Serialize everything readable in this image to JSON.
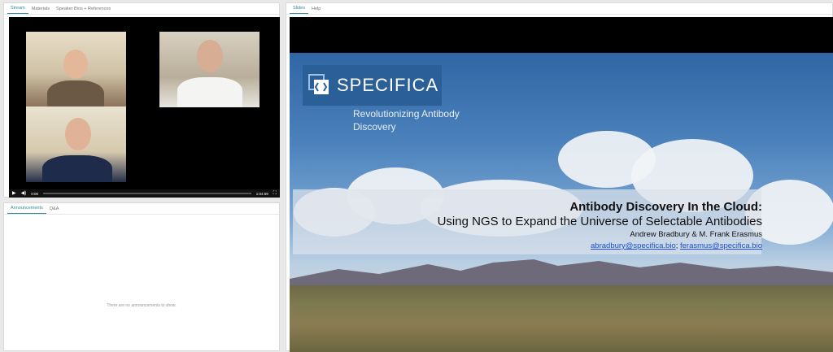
{
  "stream_panel": {
    "tabs": [
      {
        "label": "Stream",
        "active": true
      },
      {
        "label": "Materials",
        "active": false
      },
      {
        "label": "Speaker Bios + References",
        "active": false
      }
    ],
    "player": {
      "elapsed": "0:00",
      "duration": "1:04:59",
      "progress": 0.0
    }
  },
  "announce_panel": {
    "tabs": [
      {
        "label": "Announcements",
        "active": true
      },
      {
        "label": "Q&A",
        "active": false
      }
    ],
    "empty_message": "There are no announcements to show."
  },
  "slides_panel": {
    "tabs": [
      {
        "label": "Slides",
        "active": true
      },
      {
        "label": "Help",
        "active": false
      }
    ],
    "slide": {
      "logo_text": "SPECIFICA",
      "tagline": "Revolutionizing Antibody Discovery",
      "title": "Antibody Discovery In the Cloud:",
      "subtitle": "Using NGS to Expand the Universe of Selectable Antibodies",
      "authors": "Andrew Bradbury & M. Frank Erasmus",
      "email1": "abradbury@specifica.bio",
      "separator": ";",
      "email2": "ferasmus@specifica.bio"
    }
  },
  "colors": {
    "accent": "#2b8d9a",
    "logo_bg": "#2a5f97",
    "link": "#1a4fd6"
  }
}
